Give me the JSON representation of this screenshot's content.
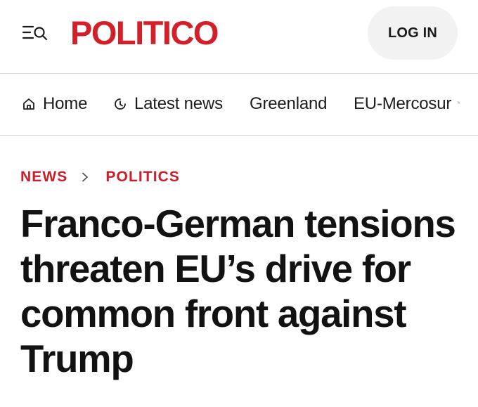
{
  "header": {
    "logo_text": "POLITICO",
    "brand_color": "#d31f27",
    "login_label": "LOG IN",
    "menu_icon": "menu-search-icon"
  },
  "nav": {
    "items": [
      {
        "label": "Home",
        "icon": "home-icon"
      },
      {
        "label": "Latest news",
        "icon": "clock-icon"
      },
      {
        "label": "Greenland"
      },
      {
        "label": "EU-Mercosur"
      }
    ]
  },
  "breadcrumb": {
    "items": [
      "NEWS",
      "POLITICS"
    ],
    "accent_color": "#c8202a"
  },
  "article": {
    "headline": "Franco-German tensions threaten EU’s drive for common front against Trump"
  }
}
